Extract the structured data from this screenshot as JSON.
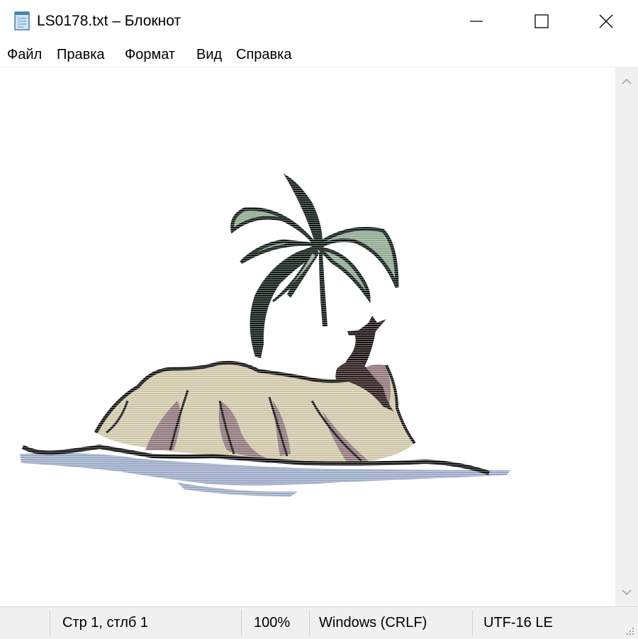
{
  "window": {
    "title": "LS0178.txt – Блокнот",
    "icon": "notepad-icon",
    "controls": [
      "minimize-icon",
      "maximize-icon",
      "close-icon"
    ]
  },
  "menu": {
    "items": [
      {
        "label": "Файл"
      },
      {
        "label": "Правка"
      },
      {
        "label": "Формат"
      },
      {
        "label": "Вид"
      },
      {
        "label": "Справка"
      }
    ]
  },
  "editor": {
    "content": "ASCII art: island with palm tree and figure"
  },
  "status": {
    "position": "Стр 1, стлб 1",
    "zoom": "100%",
    "line_endings": "Windows (CRLF)",
    "encoding": "UTF-16 LE"
  },
  "colors": {
    "palm_dark": "#0f1a14",
    "palm_leaf": "#8ea890",
    "sand": "#cfc6a8",
    "rock_shadow": "#8f747a",
    "water": "#9aa8c6",
    "outline": "#111111"
  }
}
